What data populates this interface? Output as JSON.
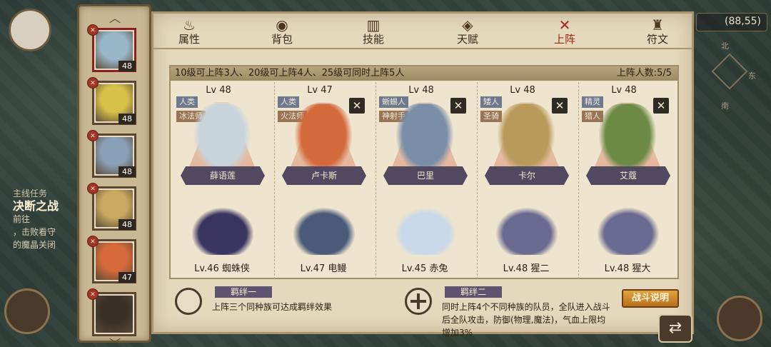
{
  "hud": {
    "coords": "(88,55)",
    "compass": {
      "north": "北",
      "east": "东",
      "south": "南"
    },
    "quest": {
      "header": "主线任务",
      "title": "决断之战",
      "lines": [
        "前往",
        "，击败看守",
        "的魔晶关闭"
      ]
    }
  },
  "roster": {
    "heroes": [
      {
        "level": "48",
        "badge": "✕",
        "color": "#9ab7c9",
        "selected": true
      },
      {
        "level": "48",
        "badge": "✕",
        "color": "#d8c14a",
        "selected": false
      },
      {
        "level": "48",
        "badge": "✕",
        "color": "#8aa0b8",
        "selected": false
      },
      {
        "level": "48",
        "badge": "✕",
        "color": "#c9a860",
        "selected": false
      },
      {
        "level": "47",
        "badge": "✕",
        "color": "#d66a3a",
        "selected": false
      },
      {
        "level": "",
        "badge": "✕",
        "color": "#3a3028",
        "selected": false
      }
    ]
  },
  "tabs": [
    {
      "label": "属性",
      "icon": "flame-icon",
      "glyph": "♨",
      "active": false
    },
    {
      "label": "背包",
      "icon": "bag-icon",
      "glyph": "◉",
      "active": false
    },
    {
      "label": "技能",
      "icon": "book-icon",
      "glyph": "▥",
      "active": false
    },
    {
      "label": "天赋",
      "icon": "eye-icon",
      "glyph": "◈",
      "active": false
    },
    {
      "label": "上阵",
      "icon": "crossed-swords-icon",
      "glyph": "✕",
      "active": true
    },
    {
      "label": "符文",
      "icon": "rune-icon",
      "glyph": "♜",
      "active": false
    }
  ],
  "lineup": {
    "rule": "10级可上阵3人、20级可上阵4人、25级可同时上阵5人",
    "count": "上阵人数:5/5",
    "heroes": [
      {
        "lv": "Lv 48",
        "race": "人类",
        "job": "冰法师",
        "name": "薛语莲",
        "removable": false,
        "color": "#c8d4dc",
        "pet": "Lv.46 蜘蛛侠",
        "pet_color": "#3a3560"
      },
      {
        "lv": "Lv 47",
        "race": "人类",
        "job": "火法师",
        "name": "卢卡斯",
        "removable": true,
        "color": "#d46a3c",
        "pet": "Lv.47 电鳗",
        "pet_color": "#4a5a78"
      },
      {
        "lv": "Lv 48",
        "race": "蜥蜴人",
        "job": "神射手",
        "name": "巴里",
        "removable": true,
        "color": "#7a8ea8",
        "pet": "Lv.45 赤兔",
        "pet_color": "#c8d8e8"
      },
      {
        "lv": "Lv 48",
        "race": "矮人",
        "job": "圣骑",
        "name": "卡尔",
        "removable": true,
        "color": "#b89a5a",
        "pet": "Lv.48 猩二",
        "pet_color": "#6a6a90"
      },
      {
        "lv": "Lv 48",
        "race": "精灵",
        "job": "猎人",
        "name": "艾蔻",
        "removable": true,
        "color": "#6c8a44",
        "pet": "Lv.48 猩大",
        "pet_color": "#6a6a90"
      }
    ]
  },
  "bonds": [
    {
      "title": "羁绊一",
      "desc": "上阵三个同种族可达成羁绊效果"
    },
    {
      "title": "羁绊二",
      "desc": "同时上阵4个不同种族的队员，全队进入战斗后全队攻击，防御(物理,魔法)，气血上限均增加3%"
    }
  ],
  "buttons": {
    "battle_info": "战斗说明",
    "back": "⇄"
  },
  "colors": {
    "panel": "#e4d8bd",
    "active_tab": "#a02818",
    "banner": "#524860"
  }
}
